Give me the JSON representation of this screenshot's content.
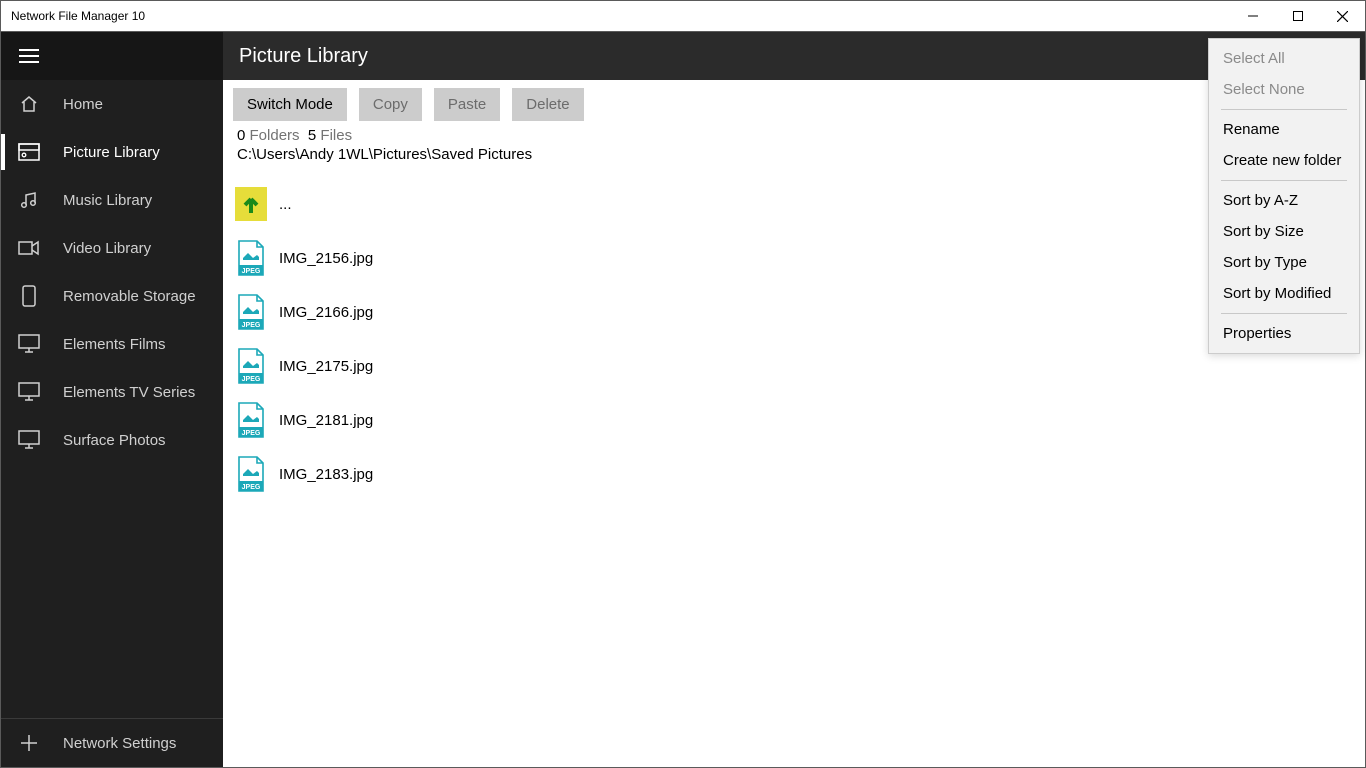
{
  "window": {
    "title": "Network File Manager 10"
  },
  "sidebar": {
    "items": [
      {
        "id": "home",
        "label": "Home"
      },
      {
        "id": "picture-library",
        "label": "Picture Library"
      },
      {
        "id": "music-library",
        "label": "Music Library"
      },
      {
        "id": "video-library",
        "label": "Video Library"
      },
      {
        "id": "removable",
        "label": "Removable Storage"
      },
      {
        "id": "elements-films",
        "label": "Elements Films"
      },
      {
        "id": "elements-tv",
        "label": "Elements TV Series"
      },
      {
        "id": "surface-photos",
        "label": "Surface Photos"
      }
    ],
    "bottom": {
      "label": "Network Settings"
    }
  },
  "header": {
    "title": "Picture Library",
    "more": "···"
  },
  "toolbar": {
    "switch_mode": "Switch Mode",
    "copy": "Copy",
    "paste": "Paste",
    "delete": "Delete"
  },
  "status": {
    "folders_count": "0",
    "folders_label": "Folders",
    "files_count": "5",
    "files_label": "Files",
    "path": "C:\\Users\\Andy 1WL\\Pictures\\Saved Pictures"
  },
  "files": {
    "up_label": "...",
    "items": [
      {
        "name": "IMG_2156.jpg"
      },
      {
        "name": "IMG_2166.jpg"
      },
      {
        "name": "IMG_2175.jpg"
      },
      {
        "name": "IMG_2181.jpg"
      },
      {
        "name": "IMG_2183.jpg"
      }
    ]
  },
  "menu": {
    "select_all": "Select All",
    "select_none": "Select None",
    "rename": "Rename",
    "create_folder": "Create new folder",
    "sort_az": "Sort by A-Z",
    "sort_size": "Sort by Size",
    "sort_type": "Sort by Type",
    "sort_modified": "Sort by Modified",
    "properties": "Properties"
  },
  "icons": {
    "jpeg_label": "JPEG"
  }
}
